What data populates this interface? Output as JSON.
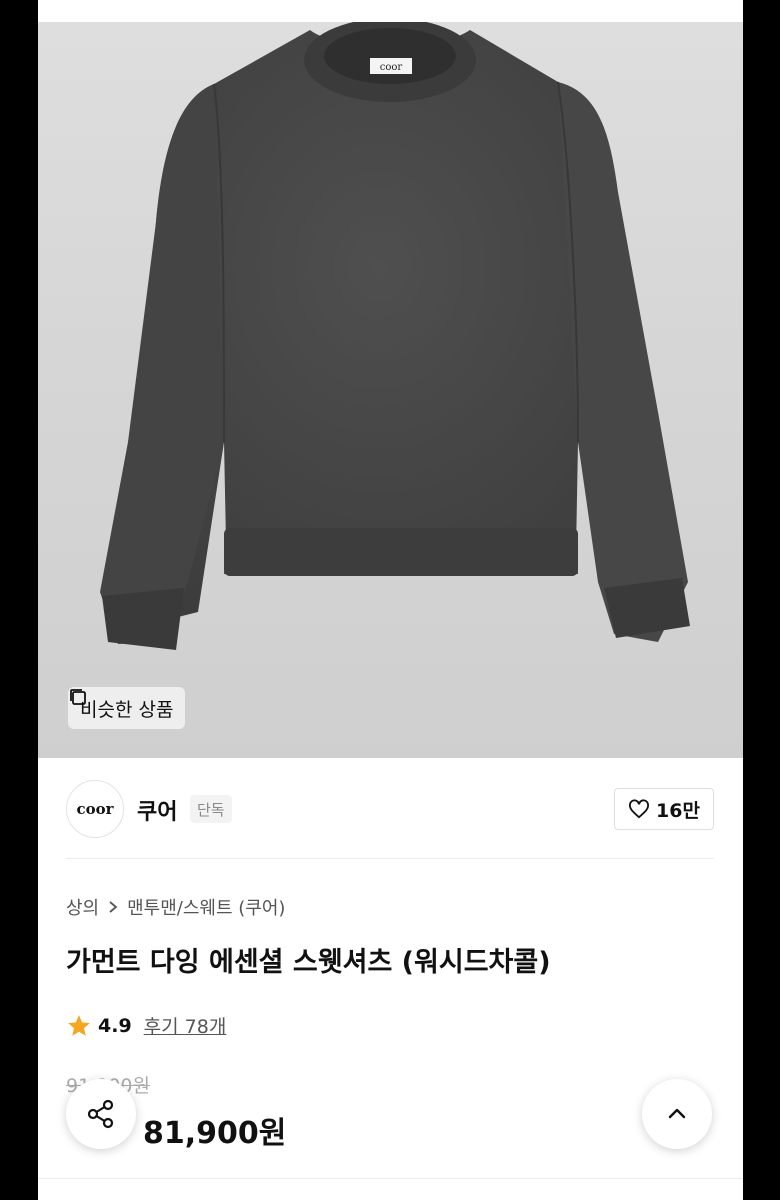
{
  "hero": {
    "image_alt": "washed charcoal crewneck sweatshirt",
    "neck_label": "coor",
    "similar_button": "비슷한 상품"
  },
  "brand": {
    "logo_text": "coor",
    "name": "쿠어",
    "badge": "단독",
    "likes": "16만"
  },
  "product": {
    "breadcrumb": [
      "상의",
      "맨투맨/스웨트 (쿠어)"
    ],
    "title": "가먼트 다잉 에센셜 스웻셔츠 (워시드차콜)",
    "rating": "4.9",
    "reviews_label": "후기 78개",
    "original_price": "91,900원",
    "sale_price": "81,900원"
  },
  "colors": {
    "star": "#F5A623",
    "sweatshirt": "#4a4a4a"
  },
  "icons": {
    "similar": "copy-squares-icon",
    "like": "heart-outline-icon",
    "share": "share-icon",
    "scroll_top": "chevron-up-icon",
    "star": "star-icon"
  }
}
